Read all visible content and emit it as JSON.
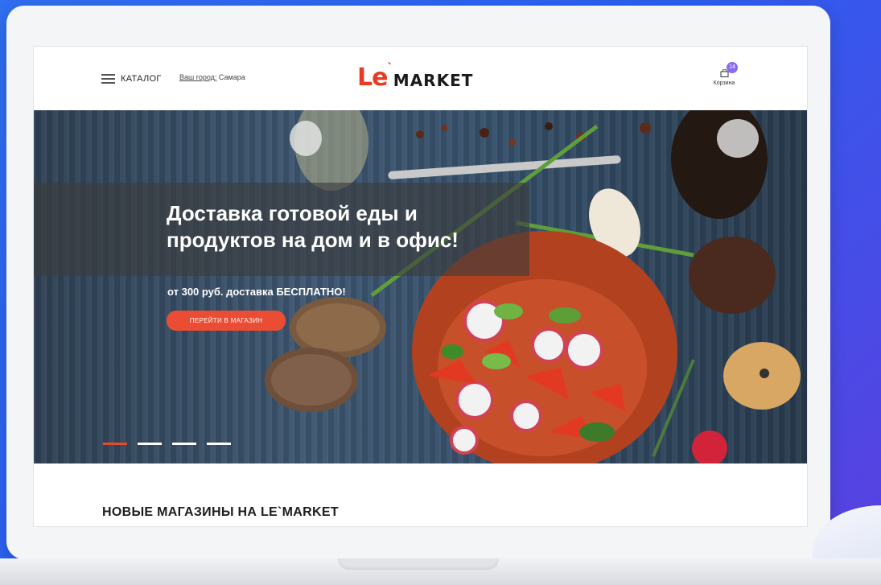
{
  "header": {
    "catalog_label": "КАТАЛОГ",
    "city_label": "Ваш город:",
    "city_value": "Самара",
    "logo_le": "Le",
    "logo_market": "MARKET",
    "cart_label": "Корзина",
    "cart_count": "14"
  },
  "hero": {
    "title_line1": "Доставка готовой еды и",
    "title_line2": "продуктов на дом и в офис!",
    "subtitle": "от 300 руб. доставка БЕСПЛАТНО!",
    "cta_label": "ПЕРЕЙТИ В МАГАЗИН",
    "slides": [
      "1",
      "2",
      "3",
      "4"
    ],
    "active_slide": 1
  },
  "section": {
    "title": "НОВЫЕ МАГАЗИНЫ НА LE`MARKET"
  },
  "colors": {
    "accent": "#e63b24",
    "button": "#ea4d33",
    "badge": "#8a6cf2"
  }
}
